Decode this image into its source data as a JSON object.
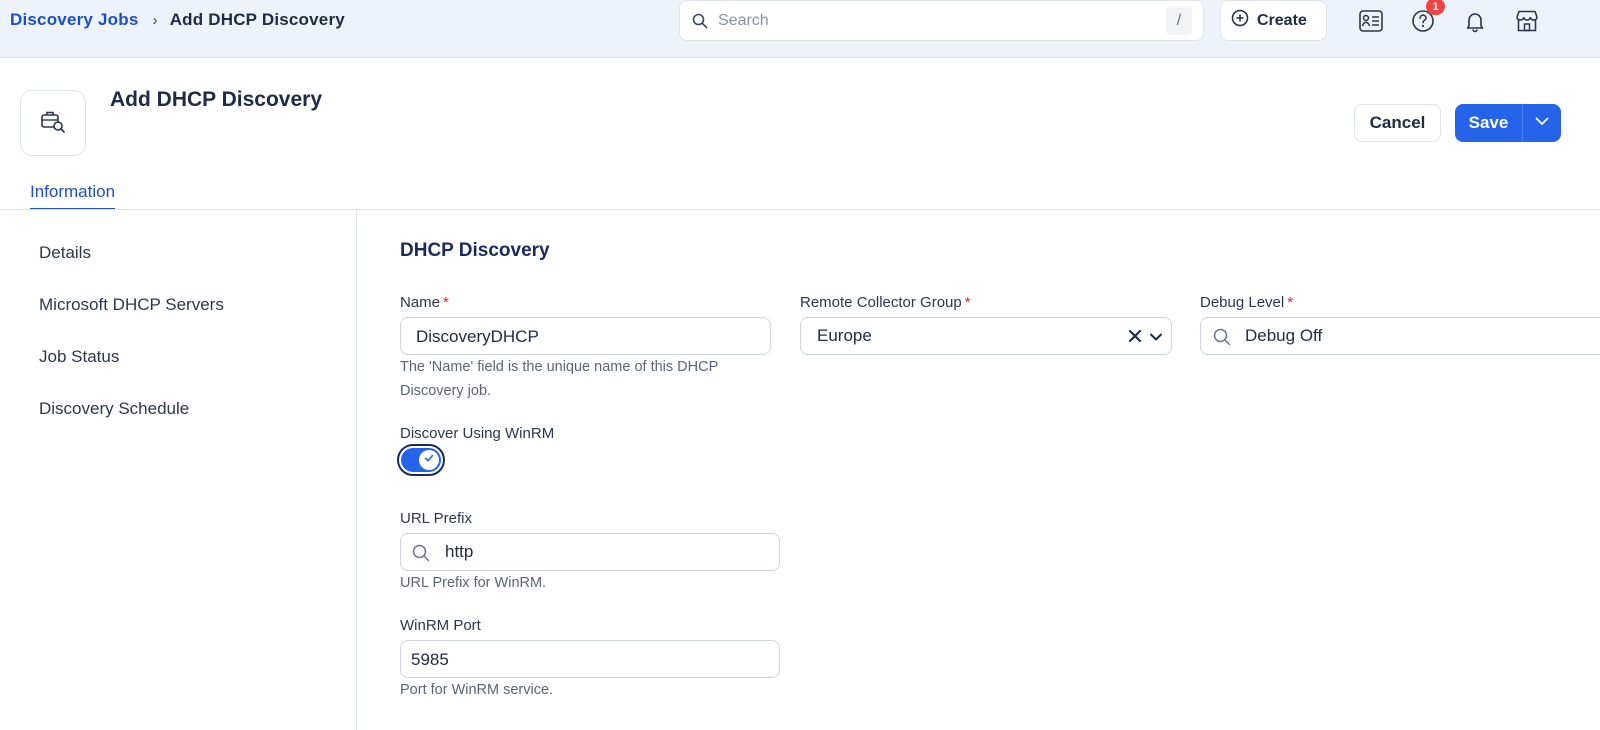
{
  "breadcrumb": {
    "parent": "Discovery Jobs",
    "separator": "›",
    "current": "Add DHCP Discovery"
  },
  "search": {
    "placeholder": "Search",
    "shortcut": "/"
  },
  "topbar": {
    "create_label": "Create",
    "help_badge": "1",
    "icons": [
      "contacts-list-icon",
      "help-icon",
      "bell-icon",
      "store-icon"
    ]
  },
  "header": {
    "title": "Add DHCP Discovery",
    "cancel_label": "Cancel",
    "save_label": "Save"
  },
  "tabs": [
    {
      "label": "Information",
      "active": true
    }
  ],
  "sidebar": {
    "items": [
      {
        "label": "Details"
      },
      {
        "label": "Microsoft DHCP Servers"
      },
      {
        "label": "Job Status"
      },
      {
        "label": "Discovery Schedule"
      }
    ]
  },
  "form": {
    "section_title": "DHCP Discovery",
    "name": {
      "label": "Name",
      "required_mark": "*",
      "value": "DiscoveryDHCP",
      "helper_line1": "The 'Name' field is the unique name of this DHCP",
      "helper_line2": "Discovery job."
    },
    "collector_group": {
      "label": "Remote Collector Group",
      "required_mark": "*",
      "value": "Europe"
    },
    "debug_level": {
      "label": "Debug Level",
      "required_mark": "*",
      "value": "Debug Off"
    },
    "winrm_toggle": {
      "label": "Discover Using WinRM",
      "checked": true
    },
    "url_prefix": {
      "label": "URL Prefix",
      "value": "http",
      "helper": "URL Prefix for WinRM."
    },
    "winrm_port": {
      "label": "WinRM Port",
      "value": "5985",
      "helper": "Port for WinRM service."
    }
  },
  "colors": {
    "accent": "#2563eb",
    "link": "#1d4fc4",
    "required": "#dc2626",
    "badge": "#ef4444",
    "topbar_bg": "#eef3fb"
  }
}
